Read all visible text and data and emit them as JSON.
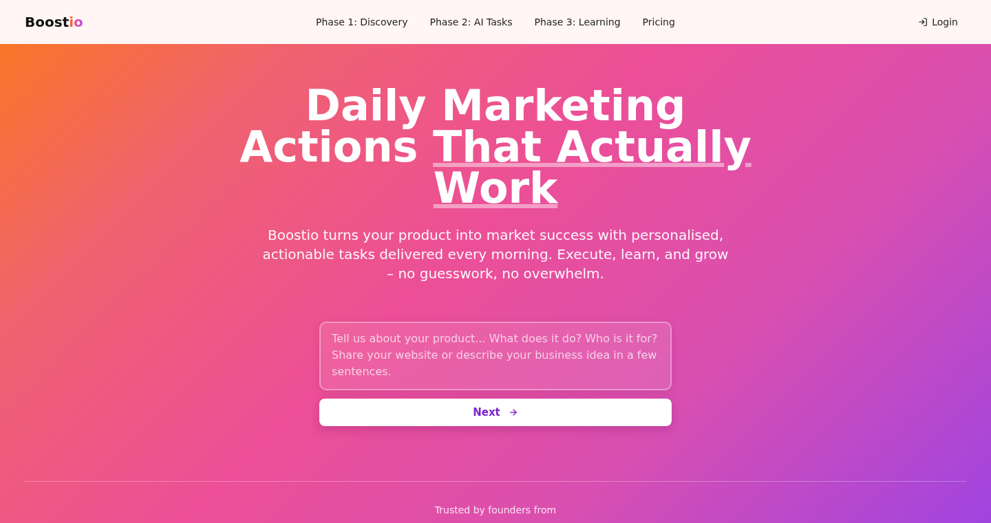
{
  "header": {
    "logo": {
      "main": "Boost",
      "accent": "io"
    },
    "nav": [
      {
        "label": "Phase 1: Discovery"
      },
      {
        "label": "Phase 2: AI Tasks"
      },
      {
        "label": "Phase 3: Learning"
      },
      {
        "label": "Pricing"
      }
    ],
    "login": "Login"
  },
  "hero": {
    "headline": "Daily Marketing Actions",
    "headline_highlight": "That Actually Work",
    "subtitle": "Boostio turns your product into market success with personalised, actionable tasks delivered every morning. Execute, learn, and grow – no guesswork, no overwhelm.",
    "input": {
      "placeholder": "Tell us about your product... What does it do? Who is it for? Share your website or describe your business idea in a few sentences."
    },
    "button": "Next"
  },
  "trusted": "Trusted by founders from"
}
